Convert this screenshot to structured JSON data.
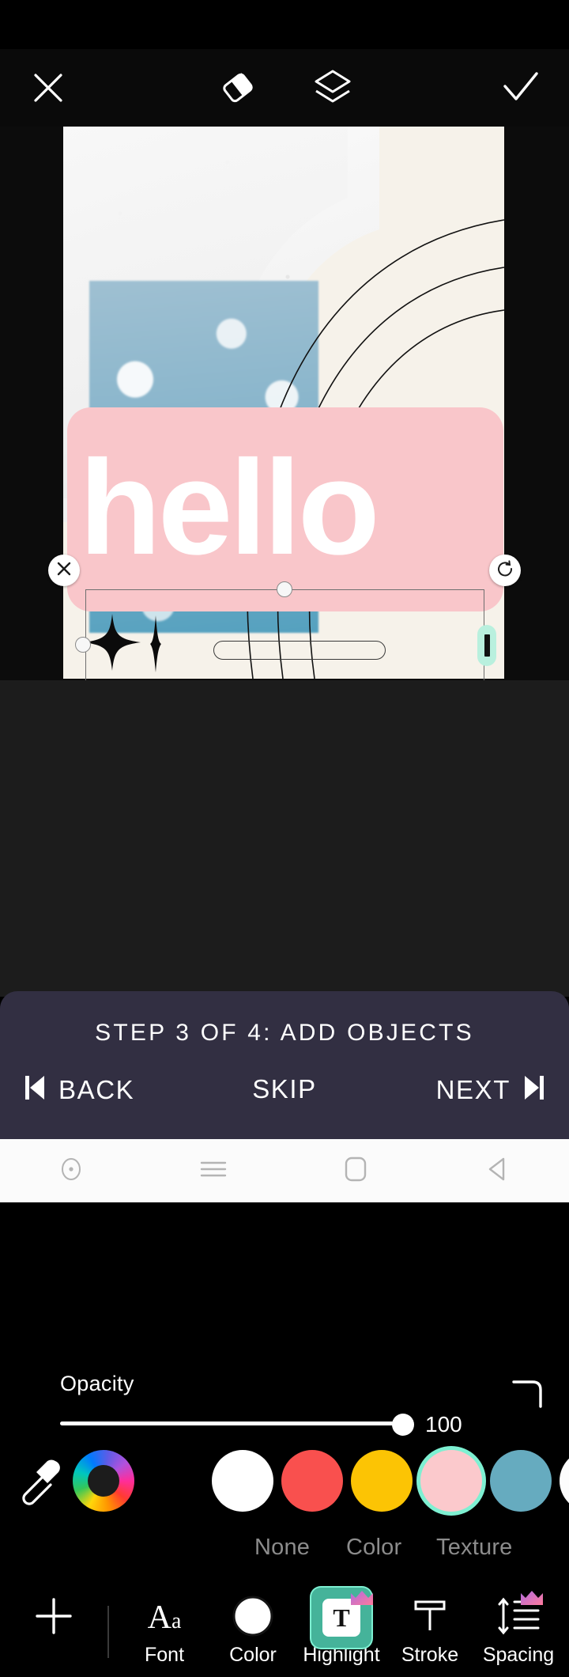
{
  "topbar": {
    "close_icon": "close-icon",
    "eraser_icon": "eraser-icon",
    "layers_icon": "layers-icon",
    "confirm_icon": "check-icon"
  },
  "canvas": {
    "text_object": {
      "value": "hello",
      "text_color": "#ffffff",
      "highlight_color": "#f9c6ca"
    },
    "background_color": "#f6f2ea",
    "photo_color": "#55a1bf",
    "handles": {
      "delete": "close-icon",
      "rotate": "rotate-icon",
      "resize": "resize-icon",
      "caret": "text-caret-handle"
    }
  },
  "opacity": {
    "label": "Opacity",
    "value": "100",
    "percent": 100,
    "corner_radius_icon": "corner-radius-icon"
  },
  "swatches": {
    "eyedropper_icon": "eyedropper-icon",
    "wheel_icon": "color-wheel-icon",
    "items": [
      {
        "name": "black",
        "hex": "#000000",
        "selected": false
      },
      {
        "name": "white",
        "hex": "#ffffff",
        "selected": false
      },
      {
        "name": "red",
        "hex": "#f9504e",
        "selected": false
      },
      {
        "name": "gold",
        "hex": "#fcc404",
        "selected": false
      },
      {
        "name": "pink",
        "hex": "#fbc9cc",
        "selected": true
      },
      {
        "name": "teal-blue",
        "hex": "#66abbf",
        "selected": false
      },
      {
        "name": "white-2",
        "hex": "#fdfdfd",
        "selected": false
      }
    ],
    "selection_ring_color": "#7ef0d2"
  },
  "modes": {
    "none": "None",
    "color": "Color",
    "texture": "Texture"
  },
  "tools": {
    "add_icon": "plus-icon",
    "items": [
      {
        "label": "Font",
        "icon": "font-icon",
        "active": false,
        "premium": false
      },
      {
        "label": "Color",
        "icon": "color-circle-icon",
        "active": false,
        "premium": false
      },
      {
        "label": "Highlight",
        "icon": "highlight-icon",
        "active": true,
        "premium": true
      },
      {
        "label": "Stroke",
        "icon": "stroke-icon",
        "active": false,
        "premium": false
      },
      {
        "label": "Spacing",
        "icon": "spacing-icon",
        "active": false,
        "premium": true
      }
    ],
    "active_color": "#45b39a"
  },
  "banner": {
    "title": "STEP 3 OF 4: ADD OBJECTS",
    "back": "BACK",
    "skip": "SKIP",
    "next": "NEXT",
    "background_color": "#322f42"
  },
  "androidnav": {
    "items": [
      "record-icon",
      "menu-icon",
      "home-icon",
      "back-icon"
    ]
  }
}
